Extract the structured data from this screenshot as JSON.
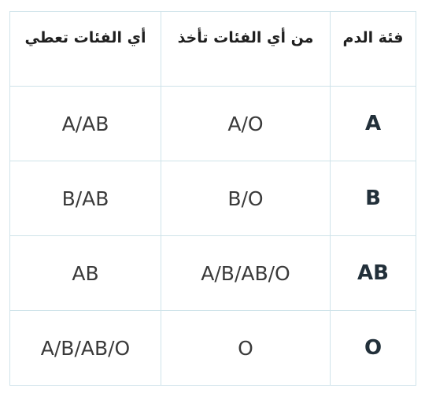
{
  "headers": {
    "gives_to": "أي الفئات تعطي",
    "receives_from": "من أي الفئات تأخذ",
    "blood_type": "فئة الدم"
  },
  "rows": [
    {
      "gives_to": "A/AB",
      "receives_from": "A/O",
      "blood_type": "A"
    },
    {
      "gives_to": "B/AB",
      "receives_from": "B/O",
      "blood_type": "B"
    },
    {
      "gives_to": "AB",
      "receives_from": "A/B/AB/O",
      "blood_type": "AB"
    },
    {
      "gives_to": "A/B/AB/O",
      "receives_from": "O",
      "blood_type": "O"
    }
  ]
}
